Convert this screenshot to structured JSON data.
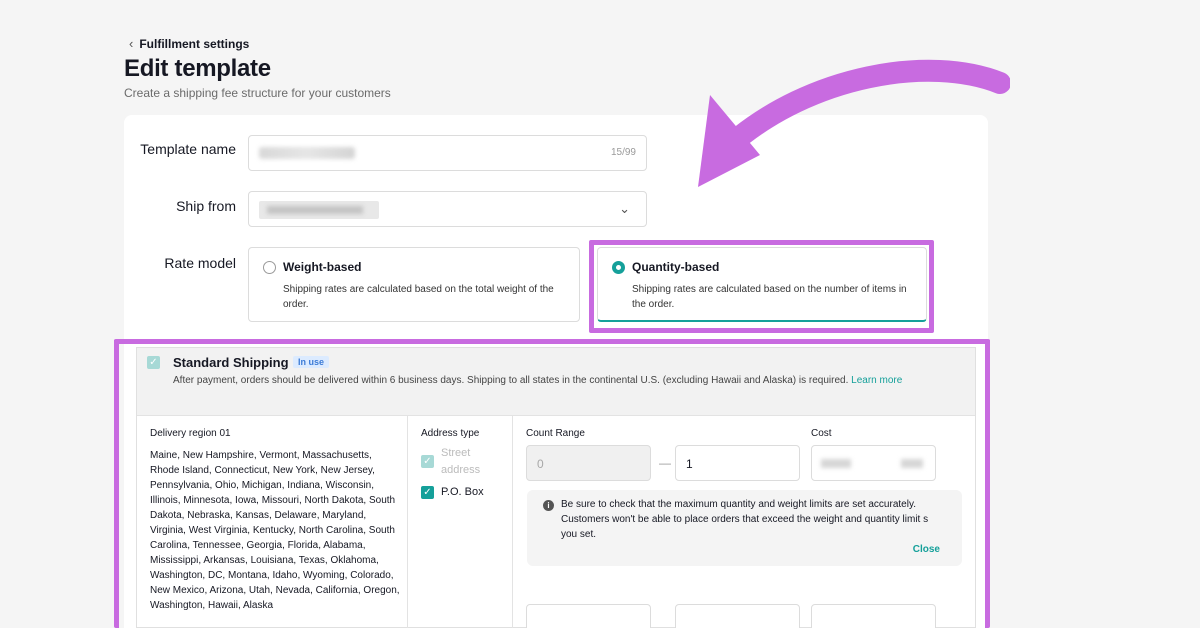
{
  "breadcrumb": {
    "back_label": "Fulfillment settings"
  },
  "header": {
    "title": "Edit template",
    "subtitle": "Create a shipping fee structure for your customers"
  },
  "form": {
    "template_name_label": "Template name",
    "template_name_counter": "15/99",
    "ship_from_label": "Ship from",
    "rate_model_label": "Rate model",
    "rate_options": [
      {
        "title": "Weight-based",
        "desc": "Shipping rates are calculated based on the total weight of the order.",
        "selected": false
      },
      {
        "title": "Quantity-based",
        "desc": "Shipping rates are calculated based on the number of items in the order.",
        "selected": true
      }
    ]
  },
  "shipping": {
    "title": "Standard Shipping",
    "badge": "In use",
    "desc": "After payment, orders should be delivered within 6 business days. Shipping to all states in the continental U.S. (excluding Hawaii and Alaska) is required.",
    "learn_more": "Learn more",
    "region_label": "Delivery region 01",
    "region_states": "Maine, New Hampshire, Vermont, Massachusetts, Rhode Island, Connecticut, New York, New Jersey, Pennsylvania, Ohio, Michigan, Indiana, Wisconsin, Illinois, Minnesota, Iowa, Missouri, North Dakota, South Dakota, Nebraska, Kansas, Delaware, Maryland, Virginia, West Virginia, Kentucky, North Carolina, South Carolina, Tennessee, Georgia, Florida, Alabama, Mississippi, Arkansas, Louisiana, Texas, Oklahoma, Washington, DC, Montana, Idaho, Wyoming, Colorado, New Mexico, Arizona, Utah, Nevada, California, Oregon, Washington, Hawaii, Alaska",
    "address_type_label": "Address type",
    "address_types": [
      "Street address",
      "P.O. Box"
    ],
    "count_range_label": "Count Range",
    "cost_label": "Cost",
    "range_from": "0",
    "range_to": "1",
    "notice": "Be sure to check that the maximum quantity and weight limits are set accurately. Customers won't be able to place orders that exceed the weight and quantity limit s you set.",
    "close_label": "Close"
  },
  "colors": {
    "accent": "#15a09a",
    "highlight": "#c86be0",
    "badge_bg": "#dcebff"
  },
  "icons": [
    "chevron-left-icon",
    "chevron-down-icon",
    "info-icon",
    "checkbox-icon",
    "arrow-annotation"
  ]
}
